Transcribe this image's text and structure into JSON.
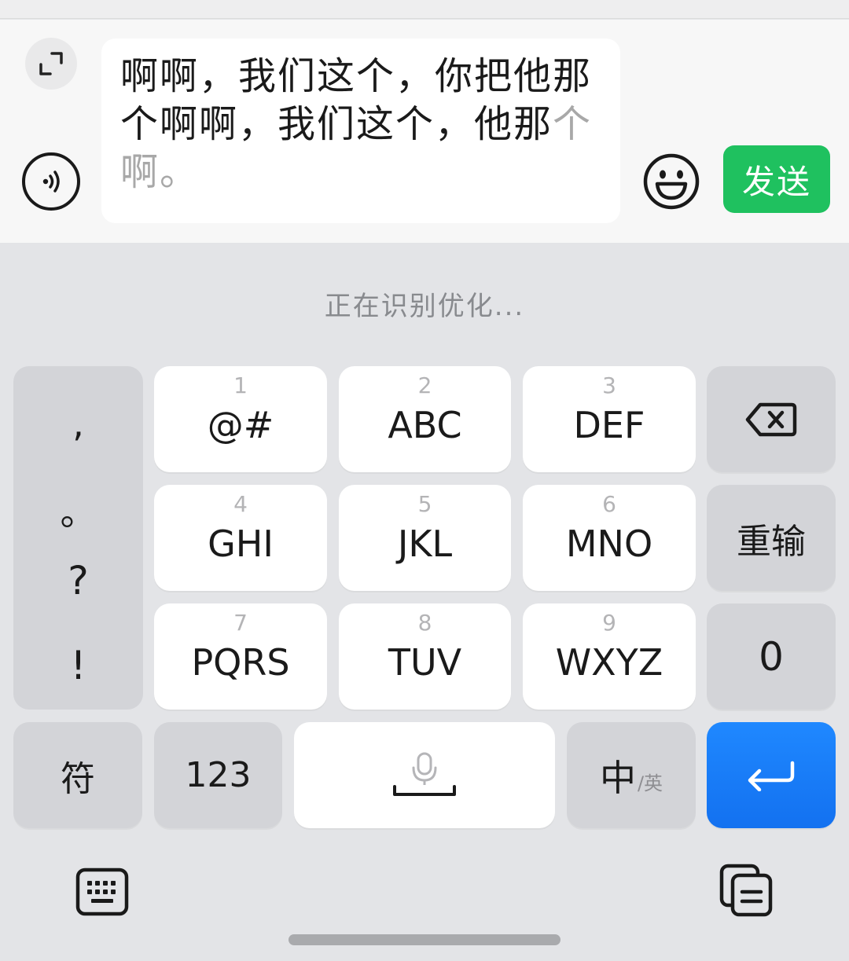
{
  "input_bar": {
    "text_confirmed": "啊啊，我们这个，你把他那个啊啊，我们这个，他那",
    "text_pending": "个啊。",
    "send_label": "发送",
    "expand_icon": "expand-icon",
    "voice_icon": "voice-wave-icon",
    "emoji_icon": "smiley-icon"
  },
  "status": {
    "text": "正在识别优化..."
  },
  "punctuation": [
    ",",
    "。",
    "?",
    "!"
  ],
  "keys": [
    {
      "num": "1",
      "letters": "@#"
    },
    {
      "num": "2",
      "letters": "ABC"
    },
    {
      "num": "3",
      "letters": "DEF"
    },
    {
      "num": "4",
      "letters": "GHI"
    },
    {
      "num": "5",
      "letters": "JKL"
    },
    {
      "num": "6",
      "letters": "MNO"
    },
    {
      "num": "7",
      "letters": "PQRS"
    },
    {
      "num": "8",
      "letters": "TUV"
    },
    {
      "num": "9",
      "letters": "WXYZ"
    }
  ],
  "side_keys": {
    "backspace_icon": "backspace-icon",
    "retype": "重输",
    "zero": "0"
  },
  "bottom_row": {
    "symbols": "符",
    "numbers": "123",
    "space_icon": "microphone-icon",
    "lang_primary": "中",
    "lang_secondary": "/英",
    "enter_icon": "enter-icon"
  },
  "toolbar": {
    "keyboard_icon": "keyboard-icon",
    "clipboard_icon": "clipboard-icon"
  },
  "colors": {
    "send": "#1fc15f",
    "enter": "#1371f0",
    "keyboard_bg": "#e3e4e7"
  }
}
